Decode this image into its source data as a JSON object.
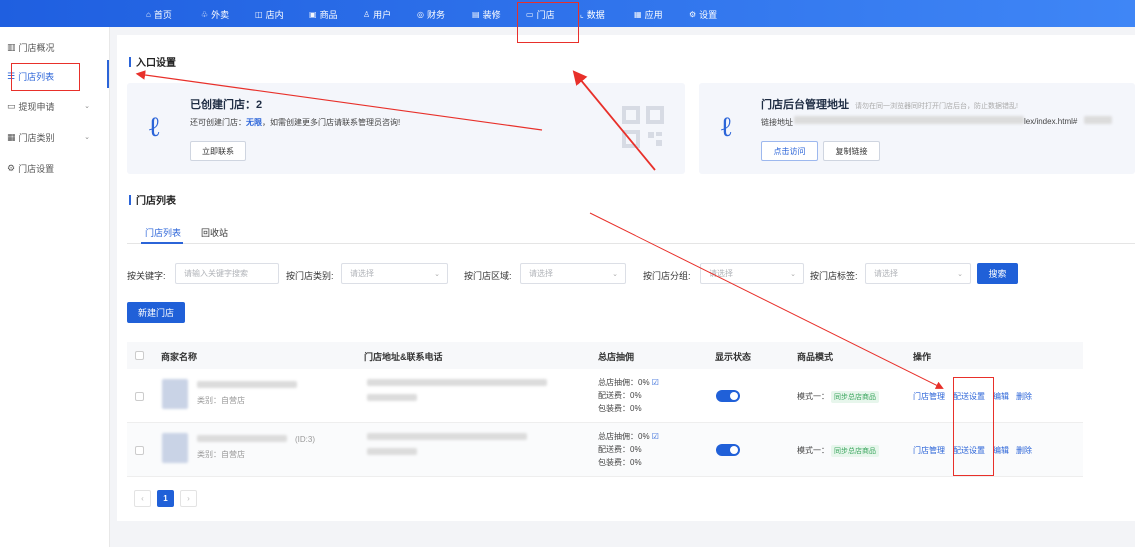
{
  "topnav": {
    "items": [
      {
        "label": "首页",
        "icon": "home-icon",
        "glyph": "⌂"
      },
      {
        "label": "外卖",
        "icon": "takeout-icon",
        "glyph": "♧"
      },
      {
        "label": "店内",
        "icon": "store-icon",
        "glyph": "◫"
      },
      {
        "label": "商品",
        "icon": "goods-icon",
        "glyph": "▣"
      },
      {
        "label": "用户",
        "icon": "user-icon",
        "glyph": "♙"
      },
      {
        "label": "财务",
        "icon": "finance-icon",
        "glyph": "◎"
      },
      {
        "label": "装修",
        "icon": "decorate-icon",
        "glyph": "▤"
      },
      {
        "label": "门店",
        "icon": "shop-icon",
        "glyph": "▭"
      },
      {
        "label": "数据",
        "icon": "data-icon",
        "glyph": "⌞"
      },
      {
        "label": "应用",
        "icon": "apps-icon",
        "glyph": "▦"
      },
      {
        "label": "设置",
        "icon": "settings-icon",
        "glyph": "⚙"
      }
    ]
  },
  "sidebar": {
    "items": [
      {
        "label": "门店概况",
        "icon": "bar-chart-icon",
        "glyph": "▥"
      },
      {
        "label": "门店列表",
        "icon": "list-icon",
        "glyph": "☰"
      },
      {
        "label": "提现申请",
        "icon": "wallet-icon",
        "glyph": "▭"
      },
      {
        "label": "门店类别",
        "icon": "category-icon",
        "glyph": "▦"
      },
      {
        "label": "门店设置",
        "icon": "gear-icon",
        "glyph": "⚙"
      }
    ]
  },
  "entry": {
    "section_title": "入口设置",
    "left_card": {
      "title": "已创建门店：2",
      "text_prefix": "还可创建门店：",
      "text_highlight": "无限",
      "text_suffix": "，如需创建更多门店请联系管理员咨询!",
      "button": "立即联系"
    },
    "right_card": {
      "title": "门店后台管理地址",
      "subtitle": "请勿在同一浏览器同时打开门店后台，防止数据错乱!",
      "link_label": "链接地址",
      "link_tail": "lex/index.html#",
      "visit_button": "点击访问",
      "copy_button": "复制链接"
    }
  },
  "list": {
    "section_title": "门店列表",
    "tabs": [
      "门店列表",
      "回收站"
    ],
    "filters": {
      "keyword_label": "按关键字:",
      "keyword_placeholder": "请输入关键字搜索",
      "category_label": "按门店类别:",
      "area_label": "按门店区域:",
      "group_label": "按门店分组:",
      "tag_label": "按门店标签:",
      "select_placeholder": "请选择",
      "search_button": "搜索"
    },
    "new_button": "新建门店",
    "columns": [
      "商家名称",
      "门店地址&联系电话",
      "总店抽佣",
      "显示状态",
      "商品模式",
      "操作"
    ],
    "rows": [
      {
        "id_text": "",
        "category": "类别：自营店",
        "commission": "总店抽佣：0%",
        "delivery_fee": "配送费：0%",
        "pack_fee": "包装费：0%",
        "mode_label": "模式一：",
        "mode_tag": "同步总店商品",
        "actions": [
          "门店管理",
          "配送设置",
          "编辑",
          "删除"
        ]
      },
      {
        "id_text": "(ID:3)",
        "category": "类别：自营店",
        "commission": "总店抽佣：0%",
        "delivery_fee": "配送费：0%",
        "pack_fee": "包装费：0%",
        "mode_label": "模式一：",
        "mode_tag": "同步总店商品",
        "actions": [
          "门店管理",
          "配送设置",
          "编辑",
          "删除"
        ]
      }
    ],
    "pager": {
      "prev": "‹",
      "current": "1",
      "next": "›"
    }
  },
  "colors": {
    "accent": "#2060d8",
    "annotation": "#e8302a",
    "tag_green": "#3aa55d"
  }
}
